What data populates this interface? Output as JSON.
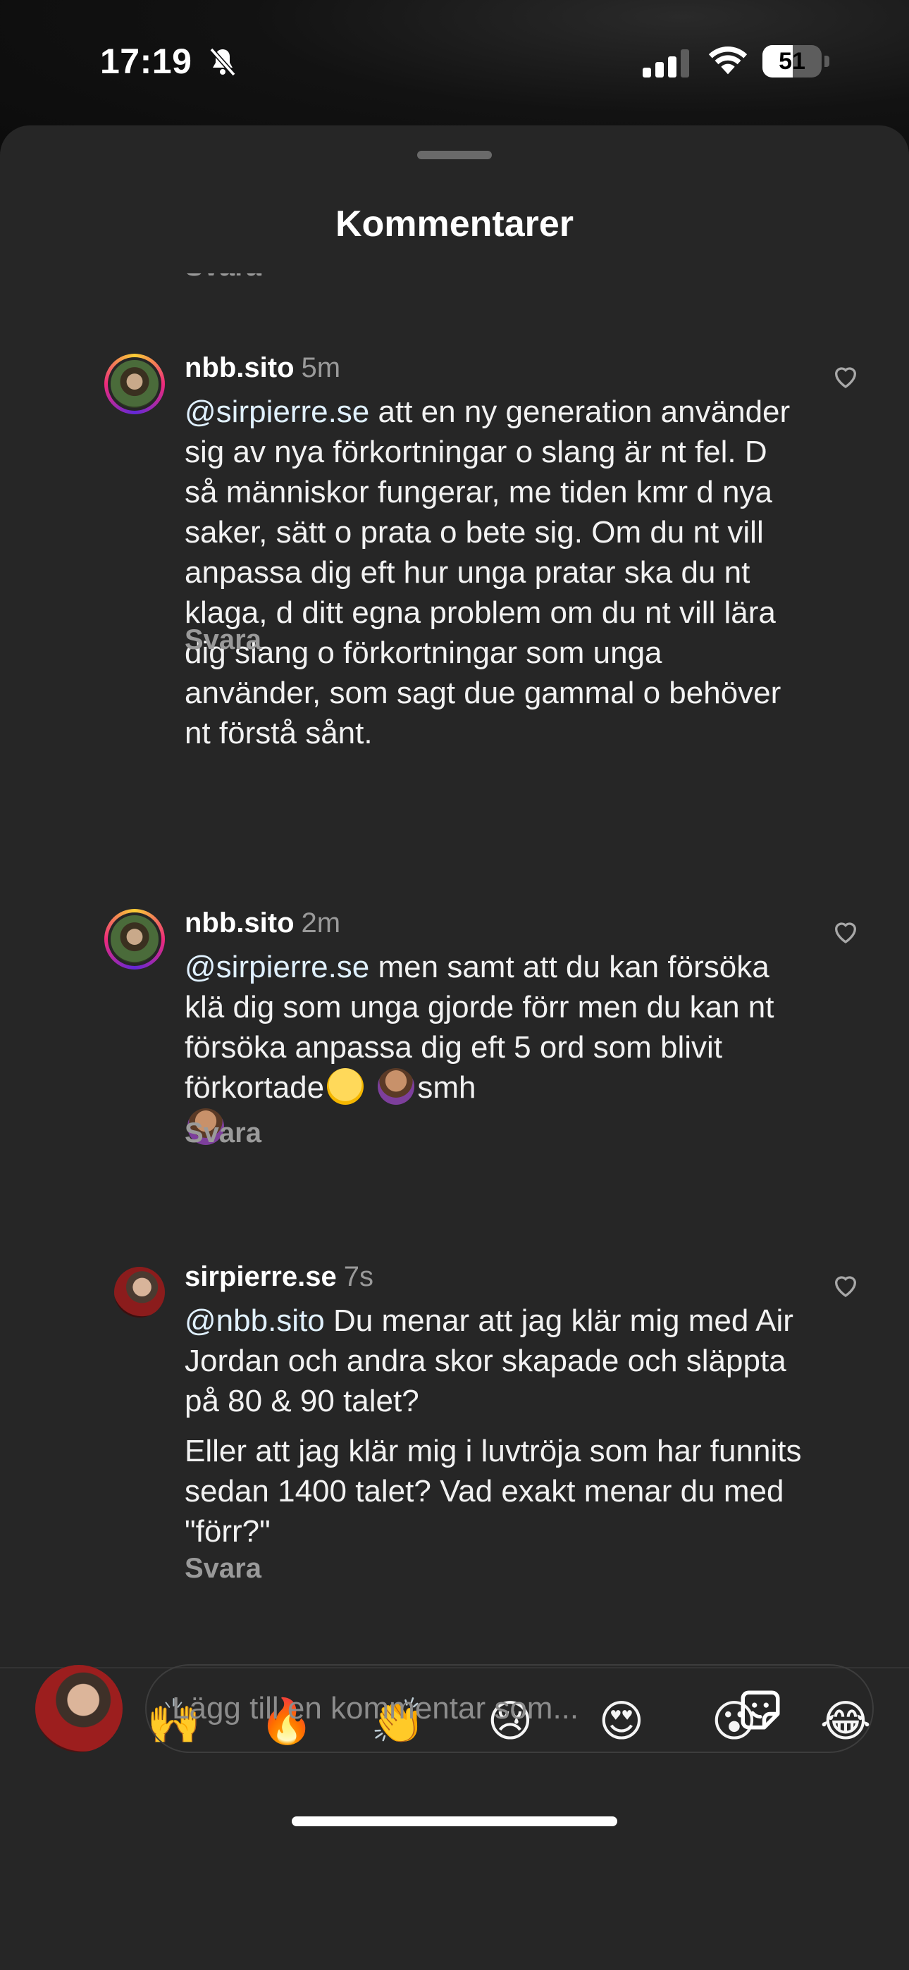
{
  "status_bar": {
    "time": "17:19",
    "battery_level": "51",
    "battery_fraction": 0.51
  },
  "sheet": {
    "title": "Kommentarer",
    "previous_reply_label": "Svara"
  },
  "comments": [
    {
      "username": "nbb.sito",
      "time_ago": "5m",
      "mention": "@sirpierre.se",
      "text": " att en ny generation använder sig av nya förkortningar o slang är nt fel. D så människor fungerar, me tiden kmr d nya saker, sätt o prata o bete sig. Om du nt vill anpassa dig eft hur unga pratar ska du nt klaga, d ditt egna problem om du nt vill lära dig slang o förkortningar som unga använder, som sagt due gammal o behöver nt förstå sånt.",
      "reply_label": "Svara"
    },
    {
      "username": "nbb.sito",
      "time_ago": "2m",
      "mention": "@sirpierre.se",
      "text": " men samt att du kan försöka klä dig som unga gjorde förr men du kan nt försöka anpassa dig eft 5 ord som blivit förkortade",
      "text_tail": "smh",
      "reply_label": "Svara"
    },
    {
      "username": "sirpierre.se",
      "time_ago": "7s",
      "mention": "@nbb.sito",
      "text": " Du menar att jag klär mig med Air Jordan och andra skor skapade och släppta på 80 & 90 talet?",
      "text_2": "Eller att jag klär mig i luvtröja som har funnits sedan 1400 talet? Vad exakt menar du med \"förr?\"",
      "reply_label": "Svara"
    }
  ],
  "emoji_bar": [
    "❤️",
    "🙌",
    "🔥",
    "👏",
    "😢",
    "😍",
    "😮",
    "😂"
  ],
  "composer": {
    "placeholder": "Lägg till en kommentar som..."
  },
  "icons": {
    "like": "heart-outline-icon",
    "sticker": "sticker-icon",
    "silent": "bell-off-icon"
  },
  "colors": {
    "sheet_bg": "#262626",
    "mention": "#e0f1ff",
    "muted": "#9a9a9a"
  }
}
